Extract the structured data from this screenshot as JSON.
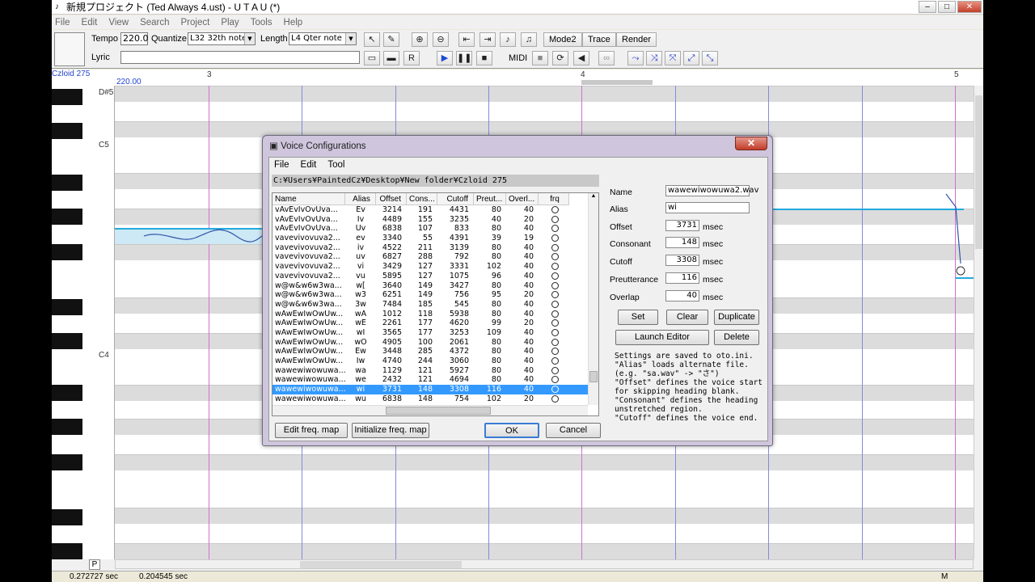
{
  "window": {
    "title": "新規プロジェクト (Ted Always 4.ust) - U T A U (*)"
  },
  "menu": [
    "File",
    "Edit",
    "View",
    "Search",
    "Project",
    "Play",
    "Tools",
    "Help"
  ],
  "toolbar": {
    "tempo_label": "Tempo",
    "tempo_value": "220.0",
    "quantize_label": "Quantize",
    "quantize_value": "L32 32th note",
    "length_label": "Length",
    "length_value": "L4  Qter note",
    "lyric_label": "Lyric",
    "lyric_value": "",
    "mode2": "Mode2",
    "trace": "Trace",
    "render": "Render",
    "midi": "MIDI"
  },
  "roll": {
    "singer_label": "Czloid 275",
    "tempo_marker": "220.00",
    "measures": [
      "3",
      "4",
      "5"
    ],
    "key_labels": [
      "D#5",
      "C5",
      "C4"
    ]
  },
  "status": {
    "left": "0.272727 sec",
    "right": "0.204545 sec",
    "mode": "M",
    "p": "P"
  },
  "dialog": {
    "title": "Voice Configurations",
    "close": "✕",
    "menu": [
      "File",
      "Edit",
      "Tool"
    ],
    "path": "C:¥Users¥PaintedCz¥Desktop¥New folder¥Czloid 275",
    "columns": [
      "Name",
      "Alias",
      "Offset",
      "Cons...",
      "Cutoff",
      "Preut...",
      "Overl...",
      "frq"
    ],
    "rows": [
      [
        "vAvEvIvOvUva...",
        "Ev",
        "3214",
        "191",
        "4431",
        "80",
        "40"
      ],
      [
        "vAvEvIvOvUva...",
        "Iv",
        "4489",
        "155",
        "3235",
        "40",
        "20"
      ],
      [
        "vAvEvIvOvUva...",
        "Uv",
        "6838",
        "107",
        "833",
        "80",
        "40"
      ],
      [
        "vavevivovuva2...",
        "ev",
        "3340",
        "55",
        "4391",
        "39",
        "19"
      ],
      [
        "vavevivovuva2...",
        "iv",
        "4522",
        "211",
        "3139",
        "80",
        "40"
      ],
      [
        "vavevivovuva2...",
        "uv",
        "6827",
        "288",
        "792",
        "80",
        "40"
      ],
      [
        "vavevivovuva2...",
        "vi",
        "3429",
        "127",
        "3331",
        "102",
        "40"
      ],
      [
        "vavevivovuva2...",
        "vu",
        "5895",
        "127",
        "1075",
        "96",
        "40"
      ],
      [
        "w@w&w6w3wa...",
        "w[",
        "3640",
        "149",
        "3427",
        "80",
        "40"
      ],
      [
        "w@w&w6w3wa...",
        "w3",
        "6251",
        "149",
        "756",
        "95",
        "20"
      ],
      [
        "w@w&w6w3wa...",
        "3w",
        "7484",
        "185",
        "545",
        "80",
        "40"
      ],
      [
        "wAwEwIwOwUw...",
        "wA",
        "1012",
        "118",
        "5938",
        "80",
        "40"
      ],
      [
        "wAwEwIwOwUw...",
        "wE",
        "2261",
        "177",
        "4620",
        "99",
        "20"
      ],
      [
        "wAwEwIwOwUw...",
        "wI",
        "3565",
        "177",
        "3253",
        "109",
        "40"
      ],
      [
        "wAwEwIwOwUw...",
        "wO",
        "4905",
        "100",
        "2061",
        "80",
        "40"
      ],
      [
        "wAwEwIwOwUw...",
        "Ew",
        "3448",
        "285",
        "4372",
        "80",
        "40"
      ],
      [
        "wAwEwIwOwUw...",
        "Iw",
        "4740",
        "244",
        "3060",
        "80",
        "40"
      ],
      [
        "wawewiwowuwa...",
        "wa",
        "1129",
        "121",
        "5927",
        "80",
        "40"
      ],
      [
        "wawewiwowuwa...",
        "we",
        "2432",
        "121",
        "4694",
        "80",
        "40"
      ],
      [
        "wawewiwowuwa...",
        "wi",
        "3731",
        "148",
        "3308",
        "116",
        "40"
      ],
      [
        "wawewiwowuwa...",
        "wu",
        "6838",
        "148",
        "754",
        "102",
        "20"
      ]
    ],
    "selected_row": 19,
    "fields": {
      "name_label": "Name",
      "name_value": "wawewiwowuwa2.wav",
      "alias_label": "Alias",
      "alias_value": "wi",
      "offset_label": "Offset",
      "offset_value": "3731",
      "consonant_label": "Consonant",
      "consonant_value": "148",
      "cutoff_label": "Cutoff",
      "cutoff_value": "3308",
      "preutterance_label": "Preutterance",
      "preutterance_value": "116",
      "overlap_label": "Overlap",
      "overlap_value": "40",
      "unit": "msec"
    },
    "buttons": {
      "set": "Set",
      "clear": "Clear",
      "duplicate": "Duplicate",
      "launch_editor": "Launch Editor",
      "delete": "Delete",
      "edit_freq": "Edit freq. map",
      "init_freq": "Initialize freq. map",
      "ok": "OK",
      "cancel": "Cancel"
    },
    "help_lines": [
      "Settings are saved to oto.ini.",
      "\"Alias\" loads alternate file.",
      "(e.g. \"sa.wav\" -> \"さ\")",
      "\"Offset\" defines the voice start",
      "for skipping heading blank.",
      "\"Consonant\" defines the heading",
      "unstretched region.",
      "\"Cutoff\" defines the voice end."
    ]
  }
}
